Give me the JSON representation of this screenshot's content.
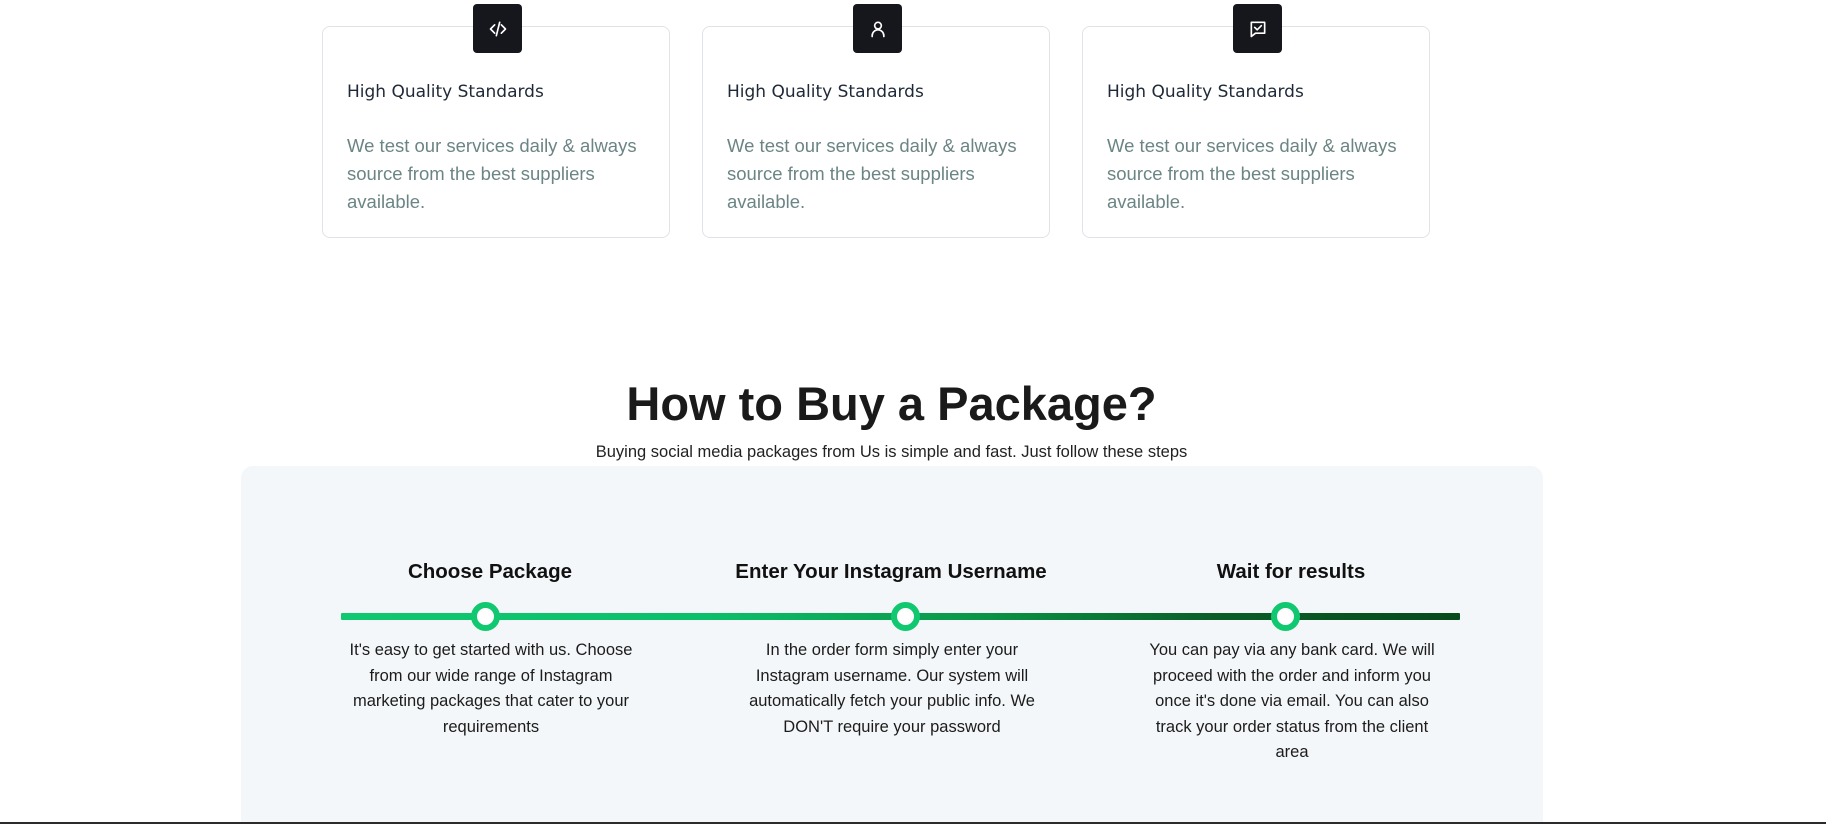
{
  "features": [
    {
      "icon": "code-icon",
      "title": "High Quality Standards",
      "text": "We test our services daily & always source from the best suppliers available."
    },
    {
      "icon": "user-icon",
      "title": "High Quality Standards",
      "text": "We test our services daily & always source from the best suppliers available."
    },
    {
      "icon": "message-check-icon",
      "title": "High Quality Standards",
      "text": "We test our services daily & always source from the best suppliers available."
    }
  ],
  "how_to_buy": {
    "title": "How to Buy a Package?",
    "subtitle": "Buying social media packages from Us is simple and fast. Just follow these steps",
    "steps": [
      {
        "title": "Choose Package",
        "text": "It's easy to get started with us. Choose from our wide range of Instagram marketing packages that cater to your requirements"
      },
      {
        "title": "Enter Your Instagram Username",
        "text": "In the order form simply enter your Instagram username. Our system will automatically fetch your public info. We DON'T require your password"
      },
      {
        "title": "Wait for results",
        "text": "You can pay via any bank card. We will proceed with the order and inform you once it's done via email. You can also track your order status from the client area"
      }
    ]
  },
  "colors": {
    "icon_bg": "#16161d",
    "accent_green": "#10c870",
    "dark_green": "#074a1c",
    "muted_text": "#6b8584",
    "panel_bg": "#f4f7f9"
  }
}
